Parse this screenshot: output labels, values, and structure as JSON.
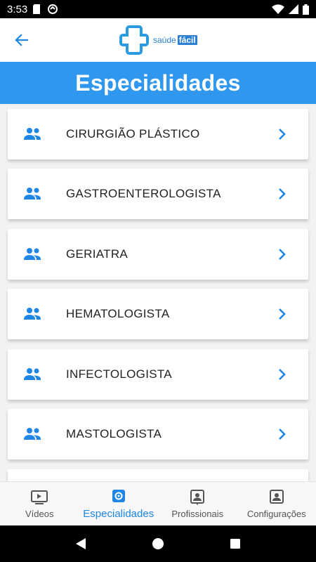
{
  "status_bar": {
    "time": "3:53"
  },
  "header": {
    "logo_brand": "saúde",
    "logo_accent": "fácil"
  },
  "page": {
    "title": "Especialidades"
  },
  "specialties": [
    {
      "label": "CIRURGIÃO PLÁSTICO"
    },
    {
      "label": "GASTROENTEROLOGISTA"
    },
    {
      "label": "GERIATRA"
    },
    {
      "label": "HEMATOLOGISTA"
    },
    {
      "label": "INFECTOLOGISTA"
    },
    {
      "label": "MASTOLOGISTA"
    }
  ],
  "bottom_nav": [
    {
      "label": "Vídeos",
      "icon": "video-icon",
      "active": false
    },
    {
      "label": "Especialidades",
      "icon": "specialty-icon",
      "active": true
    },
    {
      "label": "Profissionais",
      "icon": "professional-icon",
      "active": false
    },
    {
      "label": "Configurações",
      "icon": "settings-user-icon",
      "active": false
    }
  ],
  "colors": {
    "accent": "#2f97ee",
    "icon_blue": "#1f86e6",
    "text": "#222222"
  }
}
